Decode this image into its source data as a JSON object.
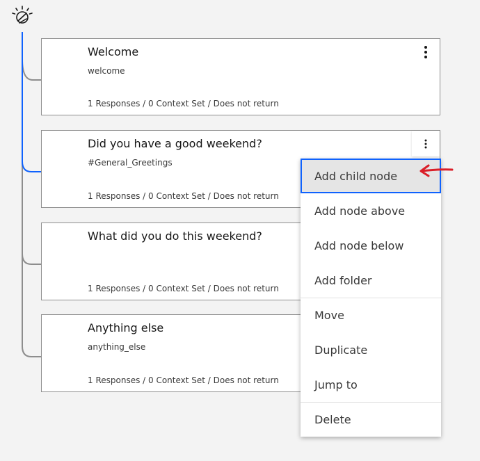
{
  "root": {
    "icon": "lightbulb-icon"
  },
  "colors": {
    "line_active": "#0f62fe",
    "line_default": "#8d8d8d",
    "annotation": "#da1e28",
    "focus": "#0f62fe"
  },
  "nodes": [
    {
      "title": "Welcome",
      "condition": "welcome",
      "summary": "1 Responses / 0 Context Set / Does not return"
    },
    {
      "title": "Did you have a good weekend?",
      "condition": "#General_Greetings",
      "summary": "1 Responses / 0 Context Set / Does not return"
    },
    {
      "title": "What did you do this weekend?",
      "condition": "",
      "summary": "1 Responses / 0 Context Set / Does not return"
    },
    {
      "title": "Anything else",
      "condition": "anything_else",
      "summary": "1 Responses / 0 Context Set / Does not return"
    }
  ],
  "menu": {
    "items": [
      {
        "label": "Add child node"
      },
      {
        "label": "Add node above"
      },
      {
        "label": "Add node below"
      },
      {
        "label": "Add folder"
      },
      {
        "label": "Move"
      },
      {
        "label": "Duplicate"
      },
      {
        "label": "Jump to"
      },
      {
        "label": "Delete"
      }
    ]
  }
}
